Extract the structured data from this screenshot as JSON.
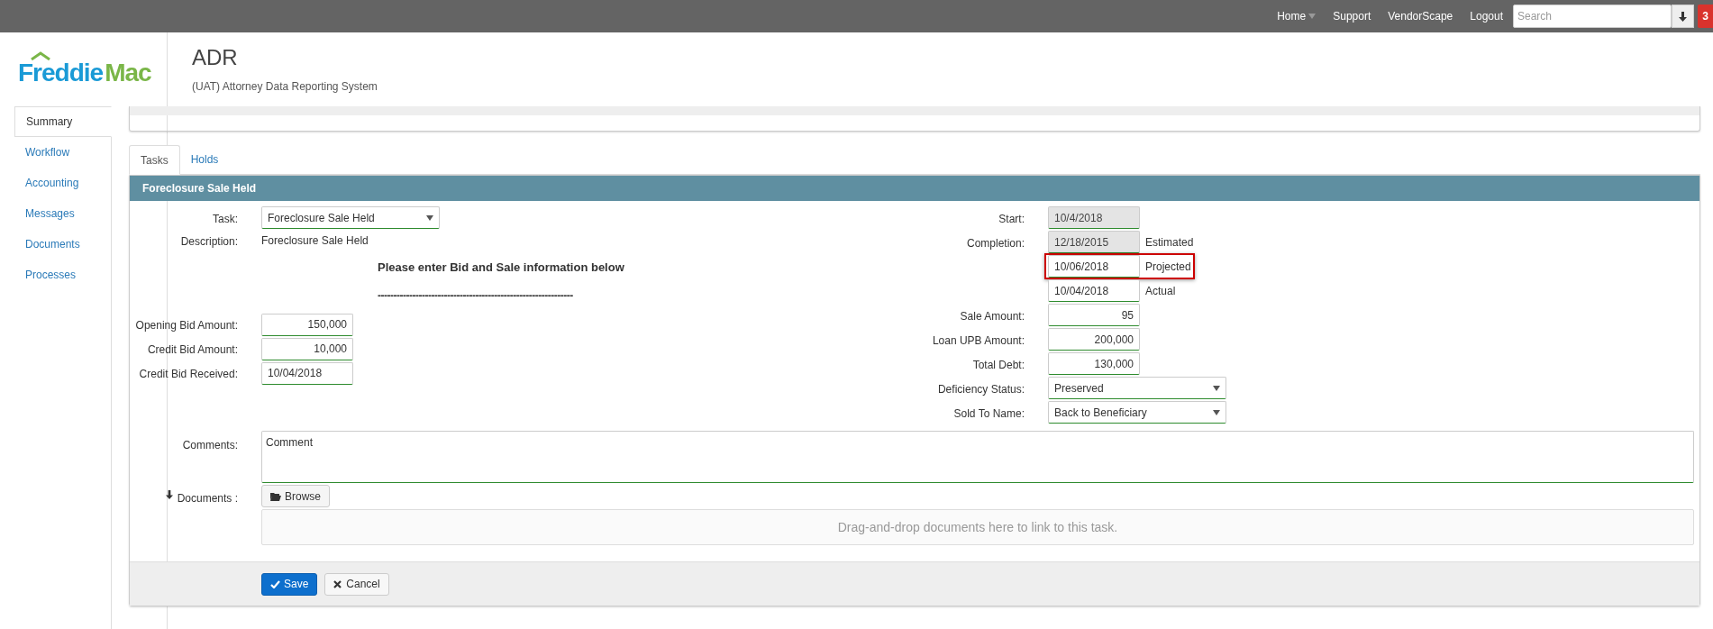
{
  "topbar": {
    "nav": [
      {
        "label": "Home",
        "caret": true
      },
      {
        "label": "Support",
        "caret": false
      },
      {
        "label": "VendorScape",
        "caret": false
      },
      {
        "label": "Logout",
        "caret": false
      }
    ],
    "search": {
      "placeholder": "Search"
    },
    "badge": "3"
  },
  "logo": {
    "part_1": "Freddie",
    "part_2": "Mac"
  },
  "app": {
    "title": "ADR",
    "subtitle": "(UAT) Attorney Data Reporting System"
  },
  "sidebar": {
    "items": [
      {
        "label": "Summary",
        "selected": true
      },
      {
        "label": "Workflow",
        "selected": false
      },
      {
        "label": "Accounting",
        "selected": false
      },
      {
        "label": "Messages",
        "selected": false
      },
      {
        "label": "Documents",
        "selected": false
      },
      {
        "label": "Processes",
        "selected": false
      }
    ]
  },
  "tabs": [
    {
      "label": "Tasks",
      "selected": true
    },
    {
      "label": "Holds",
      "selected": false
    }
  ],
  "panel": {
    "title": "Foreclosure Sale Held",
    "task": {
      "label": "Task:",
      "value": "Foreclosure Sale Held"
    },
    "description": {
      "label": "Description:",
      "value": "Foreclosure Sale Held"
    },
    "heading": "Please enter Bid and Sale information below",
    "divider": "--------------------------------------------------------------",
    "left_fields": [
      {
        "label": "Opening Bid Amount:",
        "value": "150,000",
        "kind": "number"
      },
      {
        "label": "Credit Bid Amount:",
        "value": "10,000",
        "kind": "number"
      },
      {
        "label": "Credit Bid Received:",
        "value": "10/04/2018",
        "kind": "date"
      }
    ],
    "right_fields": [
      {
        "label": "Start:",
        "value": "10/4/2018",
        "kind": "date",
        "readonly": true,
        "highlighted": false
      },
      {
        "label": "Completion:",
        "value": "12/18/2015",
        "kind": "date",
        "readonly": true,
        "note": "Estimated",
        "highlighted": false
      },
      {
        "value": "10/06/2018",
        "kind": "date",
        "readonly": false,
        "note": "Projected",
        "highlighted": true
      },
      {
        "value": "10/04/2018",
        "kind": "date",
        "readonly": false,
        "note": "Actual",
        "highlighted": false
      },
      {
        "label": "Sale Amount:",
        "value": "95",
        "kind": "number",
        "readonly": false,
        "highlighted": false
      },
      {
        "label": "Loan UPB Amount:",
        "value": "200,000",
        "kind": "number",
        "readonly": false,
        "highlighted": false
      },
      {
        "label": "Total Debt:",
        "value": "130,000",
        "kind": "number",
        "readonly": false,
        "highlighted": false
      },
      {
        "label": "Deficiency Status:",
        "value": "Preserved",
        "kind": "select",
        "highlighted": false
      },
      {
        "label": "Sold To Name:",
        "value": "Back to Beneficiary",
        "kind": "select",
        "highlighted": false
      }
    ],
    "comments": {
      "label": "Comments:",
      "value": "Comment"
    },
    "documents": {
      "label": "Documents :",
      "browse": "Browse",
      "dropzone": "Drag-and-drop documents here to link to this task."
    },
    "buttons": {
      "save": "Save",
      "cancel": "Cancel"
    }
  }
}
